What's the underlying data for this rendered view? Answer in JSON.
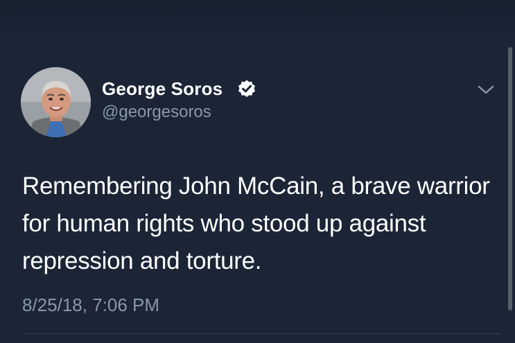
{
  "tweet": {
    "display_name": "George Soros",
    "handle": "@georgesoros",
    "verified_icon": "verified-badge-icon",
    "menu_icon": "chevron-down-icon",
    "text": "Remembering John McCain, a brave warrior for human rights who stood up against repression and torture.",
    "timestamp": "8/25/18, 7:06 PM"
  },
  "colors": {
    "background": "#1b2536",
    "primary_text": "#ffffff",
    "secondary_text": "#8899a6",
    "divider": "#38444d"
  }
}
